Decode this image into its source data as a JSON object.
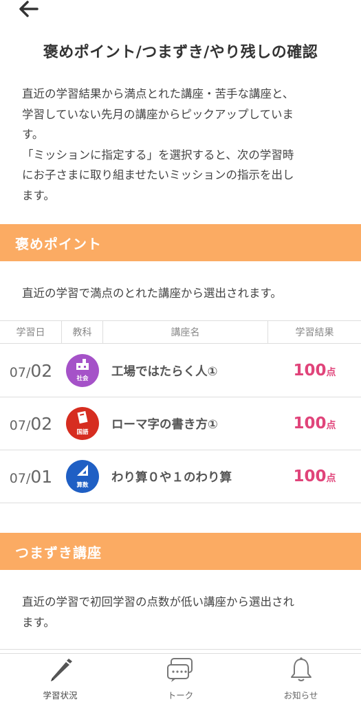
{
  "header": {
    "back_icon": "arrow-left-icon",
    "title": "褒めポイント/つまずき/やり残しの確認"
  },
  "intro": {
    "lines": [
      "直近の学習結果から満点とれた講座・苦手な講座と、",
      "学習していない先月の講座からピックアップしていま",
      "す。",
      "「ミッションに指定する」を選択すると、次の学習時",
      "にお子さまに取り組ませたいミッションの指示を出し",
      "ます。"
    ]
  },
  "praise": {
    "heading": "褒めポイント",
    "description": "直近の学習で満点のとれた講座から選出されます。",
    "columns": [
      "学習日",
      "教科",
      "講座名",
      "学習結果"
    ],
    "rows": [
      {
        "month": "07",
        "slash": "/",
        "day": "02",
        "subject": "社会",
        "subject_color": "#a552c8",
        "icon": "factory-icon",
        "lesson": "工場ではたらく人①",
        "score": "100",
        "unit": "点"
      },
      {
        "month": "07",
        "slash": "/",
        "day": "02",
        "subject": "国語",
        "subject_color": "#d62d20",
        "icon": "book-icon",
        "lesson": "ローマ字の書き方①",
        "score": "100",
        "unit": "点"
      },
      {
        "month": "07",
        "slash": "/",
        "day": "01",
        "subject": "算数",
        "subject_color": "#1f5fc4",
        "icon": "triangle-ruler-icon",
        "lesson": "わり算０や１のわり算",
        "score": "100",
        "unit": "点"
      }
    ]
  },
  "stumble": {
    "heading": "つまずき講座",
    "description_lines": [
      "直近の学習で初回学習の点数が低い講座から選出され",
      "ます。"
    ]
  },
  "tabbar": {
    "items": [
      {
        "label": "学習状況",
        "icon": "pencil-icon"
      },
      {
        "label": "トーク",
        "icon": "chat-icon"
      },
      {
        "label": "お知らせ",
        "icon": "bell-icon"
      }
    ]
  },
  "colors": {
    "section_header": "#fbab63",
    "score": "#e0447a"
  }
}
